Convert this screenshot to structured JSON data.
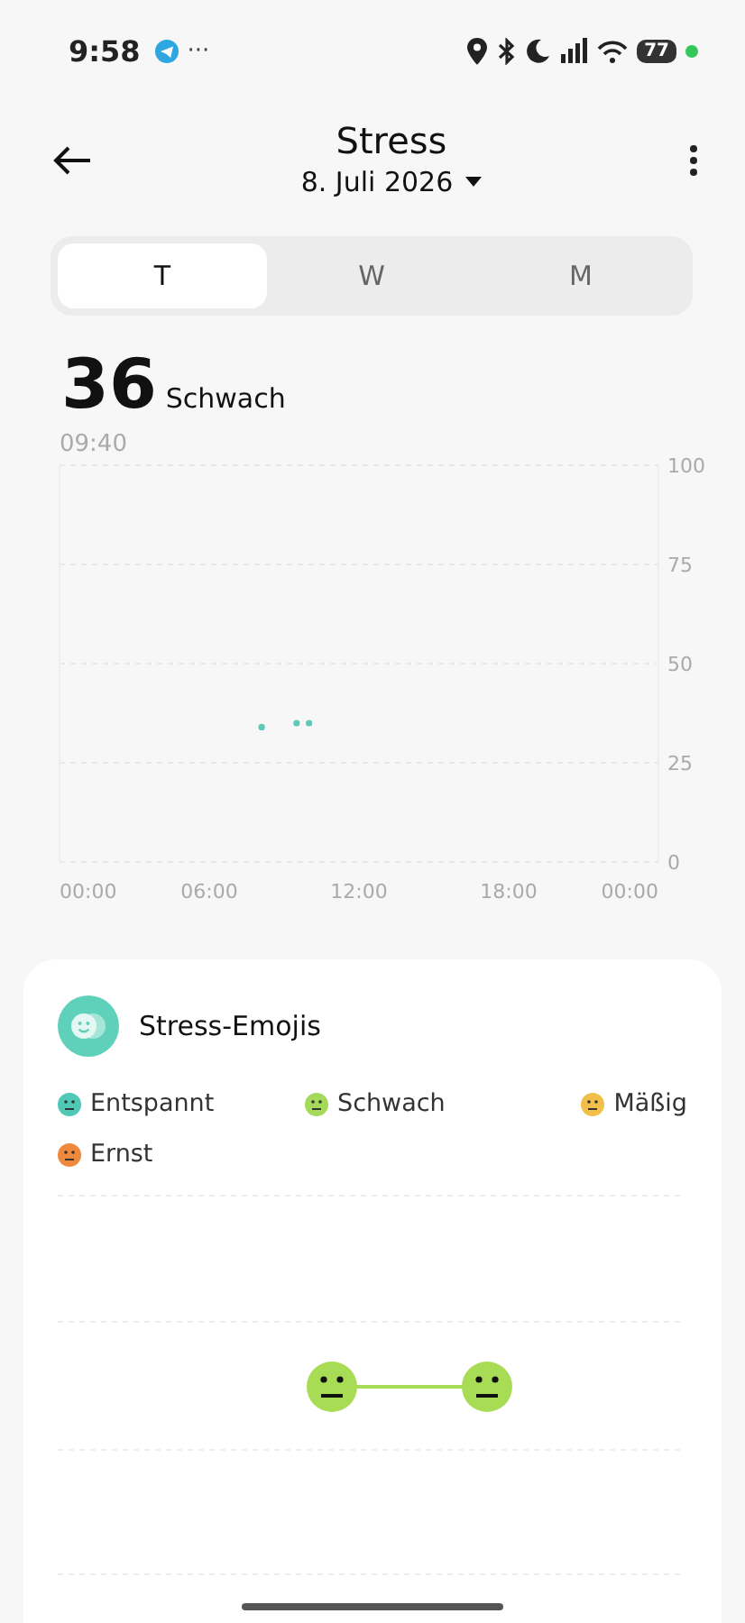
{
  "status_bar": {
    "time": "9:58",
    "dots": "···",
    "battery": "77"
  },
  "header": {
    "title": "Stress",
    "date": "8. Juli 2026"
  },
  "tabs": [
    {
      "label": "T",
      "selected": true
    },
    {
      "label": "W",
      "selected": false
    },
    {
      "label": "M",
      "selected": false
    }
  ],
  "reading": {
    "value": "36",
    "level_text": "Schwach",
    "time": "09:40"
  },
  "chart_data": {
    "type": "scatter",
    "x": [
      8.1,
      9.5,
      10.0
    ],
    "series": [
      {
        "color": "#5cc8b8",
        "values": [
          34,
          35,
          35
        ]
      }
    ],
    "grid": true,
    "xlim": [
      0,
      24
    ],
    "ylim": [
      0,
      100
    ],
    "xticks": [
      {
        "value": 0,
        "label": "00:00"
      },
      {
        "value": 6,
        "label": "06:00"
      },
      {
        "value": 12,
        "label": "12:00"
      },
      {
        "value": 18,
        "label": "18:00"
      },
      {
        "value": 24,
        "label": "00:00"
      }
    ],
    "yticks": [
      0,
      25,
      50,
      75,
      100
    ]
  },
  "emoji_card": {
    "title": "Stress-Emojis",
    "legend": [
      {
        "label": "Entspannt",
        "color": "#4fc9b5"
      },
      {
        "label": "Schwach",
        "color": "#a4d95a"
      },
      {
        "label": "Mäßig",
        "color": "#f2bf4a"
      },
      {
        "label": "Ernst",
        "color": "#ef8a3c"
      }
    ]
  }
}
